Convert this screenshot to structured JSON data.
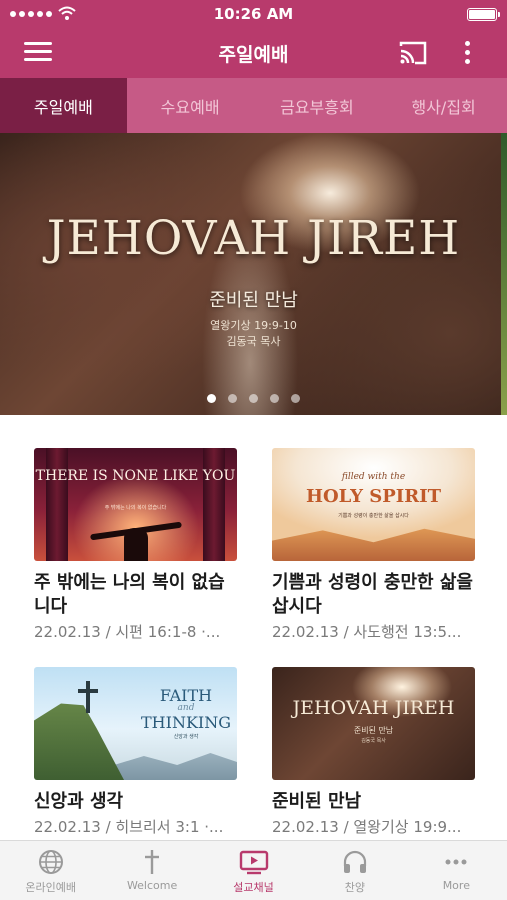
{
  "status_bar": {
    "time": "10:26 AM"
  },
  "app_bar": {
    "title": "주일예배"
  },
  "tabs": [
    {
      "label": "주일예배",
      "active": true
    },
    {
      "label": "수요예배",
      "active": false
    },
    {
      "label": "금요부흥회",
      "active": false
    },
    {
      "label": "행사/집회",
      "active": false
    }
  ],
  "hero": {
    "headline": "JEHOVAH JIREH",
    "subtitle": "준비된 만남",
    "scripture": "열왕기상 19:9-10",
    "pastor": "김동국 목사",
    "slide_count": 5,
    "active_slide": 1
  },
  "cards": [
    {
      "title": "주 밖에는 나의 복이 없습니다",
      "meta": "22.02.13 / 시편 16:1-8 ·...",
      "thumb_headline": "THERE IS NONE LIKE YOU",
      "thumb_small": "주 밖에는 나의 복이 없습니다"
    },
    {
      "title": "기쁨과 성령이 충만한 삶을 삽시다",
      "meta": "22.02.13 / 사도행전 13:5...",
      "thumb_script": "filled with the",
      "thumb_headline": "HOLY SPIRIT",
      "thumb_small": "기쁨과 성령이 충만한 삶을 삽시다"
    },
    {
      "title": "신앙과 생각",
      "meta": "22.02.13 / 히브리서 3:1 ·...",
      "thumb_line1": "FAITH",
      "thumb_and": "and",
      "thumb_line2": "THINKING",
      "thumb_small": "신앙과 생각"
    },
    {
      "title": "준비된 만남",
      "meta": "22.02.13 / 열왕기상 19:9...",
      "thumb_headline": "JEHOVAH JIREH",
      "thumb_sub": "준비된 만남",
      "thumb_small": "김동국 목사"
    }
  ],
  "bottom_nav": [
    {
      "label": "온라인예배",
      "icon": "globe-icon",
      "active": false
    },
    {
      "label": "Welcome",
      "icon": "cross-icon",
      "active": false
    },
    {
      "label": "설교채널",
      "icon": "play-screen-icon",
      "active": true
    },
    {
      "label": "찬양",
      "icon": "headphones-icon",
      "active": false
    },
    {
      "label": "More",
      "icon": "more-horizontal-icon",
      "active": false
    }
  ],
  "colors": {
    "brand": "#b83a6c",
    "tab_bar": "#c65a86",
    "tab_active": "#7a1f45"
  }
}
